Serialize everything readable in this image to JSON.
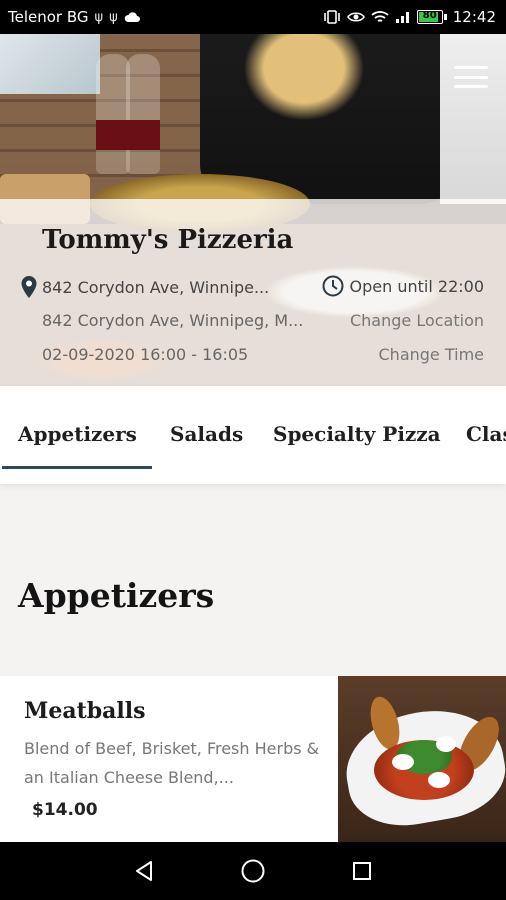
{
  "status_bar": {
    "carrier": "Telenor BG",
    "battery_level": "80",
    "time": "12:42"
  },
  "restaurant": {
    "name": "Tommy's Pizzeria",
    "address_short": "842 Corydon Ave, Winnipe...",
    "open_status": "Open until 22:00",
    "address_full": "842 Corydon Ave, Winnipeg, M...",
    "change_location_label": "Change Location",
    "pickup_time": "02-09-2020 16:00 - 16:05",
    "change_time_label": "Change Time"
  },
  "tabs": [
    {
      "label": "Appetizers",
      "active": true
    },
    {
      "label": "Salads",
      "active": false
    },
    {
      "label": "Specialty Pizza",
      "active": false
    },
    {
      "label": "Clas",
      "active": false
    }
  ],
  "section": {
    "title": "Appetizers"
  },
  "items": [
    {
      "name": "Meatballs",
      "description": "Blend of Beef, Brisket, Fresh Herbs & an Italian Cheese Blend,...",
      "price": "$14.00"
    }
  ],
  "colors": {
    "tab_underline": "#2c4a5c",
    "status_bar_bg": "#000000",
    "battery_fill": "#3ec44a"
  },
  "icons": {
    "menu": "hamburger-menu-icon",
    "location": "map-pin-icon",
    "clock": "clock-icon",
    "nav_back": "triangle-back-icon",
    "nav_home": "circle-home-icon",
    "nav_recent": "square-recents-icon"
  }
}
